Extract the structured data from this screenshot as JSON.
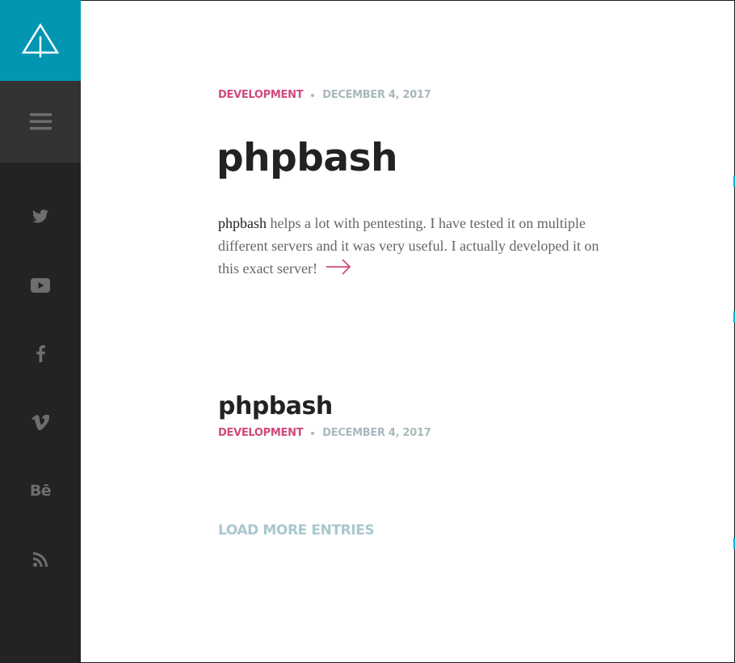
{
  "colors": {
    "accent": "#0396b3",
    "category": "#d0497d",
    "muted": "#a9b8bc",
    "sidebar": "#232323",
    "menu_bg": "#333333",
    "heading": "#222222",
    "body_text": "#666666",
    "load_more": "#a9c8ce"
  },
  "sidebar": {
    "logo_icon": "tree-logo-icon",
    "menu_icon": "hamburger-menu-icon",
    "social": [
      {
        "icon": "twitter-icon"
      },
      {
        "icon": "youtube-icon"
      },
      {
        "icon": "facebook-icon"
      },
      {
        "icon": "vimeo-icon"
      },
      {
        "icon": "behance-icon",
        "text": "Bē"
      },
      {
        "icon": "rss-icon"
      }
    ]
  },
  "featured_post": {
    "category": "DEVELOPMENT",
    "date": "DECEMBER 4, 2017",
    "title": "phpbash",
    "excerpt_lead": "phpbash",
    "excerpt_rest": " helps a lot with pentesting. I have tested it on multiple different servers and it was very useful. I actually developed it on this exact server!",
    "read_more_icon": "arrow-right-icon"
  },
  "post_list": [
    {
      "title": "phpbash",
      "category": "DEVELOPMENT",
      "date": "DECEMBER 4, 2017"
    }
  ],
  "load_more_label": "LOAD MORE ENTRIES"
}
